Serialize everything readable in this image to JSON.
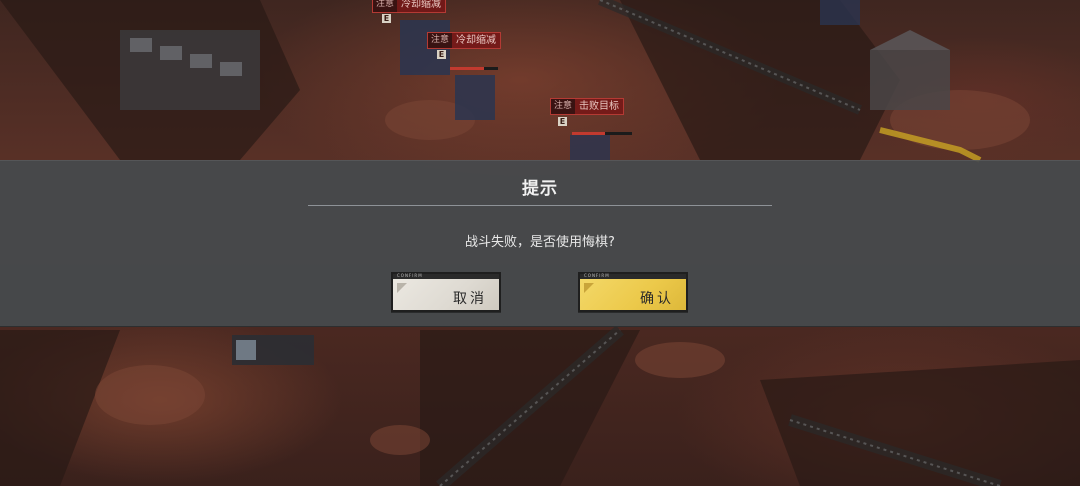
{
  "battlefield": {
    "unit_tags": [
      {
        "kind": "注意",
        "text": "冷却缩减"
      },
      {
        "kind": "注意",
        "text": "冷却缩减"
      },
      {
        "kind": "注意",
        "text": "击败目标"
      }
    ],
    "unit_markers": [
      "E",
      "E",
      "E"
    ]
  },
  "dialog": {
    "title": "提示",
    "message": "战斗失败，是否使用悔棋?",
    "cancel_label": "取消",
    "confirm_label": "确认",
    "button_strip_text": "CONFIRM"
  },
  "colors": {
    "confirm_accent": "#ecc94a",
    "cancel_face": "#dedad2",
    "dialog_band": "#464a4e",
    "enemy_tag": "#781616"
  }
}
